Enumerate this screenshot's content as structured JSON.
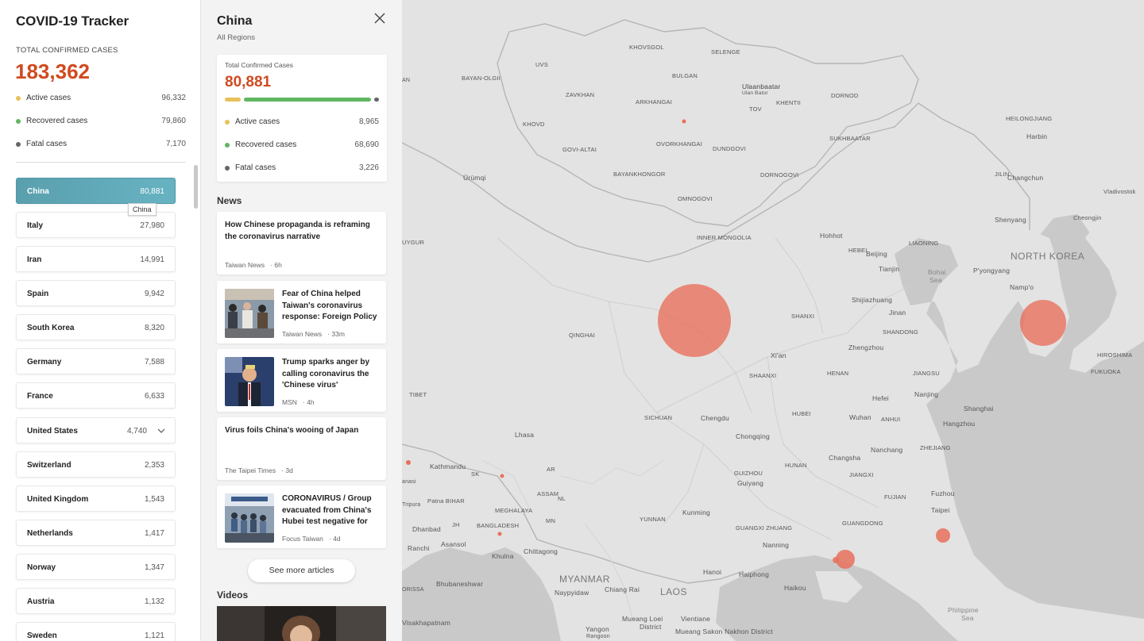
{
  "app": {
    "title": "COVID-19 Tracker"
  },
  "global": {
    "total_label": "TOTAL CONFIRMED CASES",
    "total_value": "183,362",
    "stats": [
      {
        "label": "Active cases",
        "value": "96,332",
        "color": "#e8c15a"
      },
      {
        "label": "Recovered cases",
        "value": "79,860",
        "color": "#5fb761"
      },
      {
        "label": "Fatal cases",
        "value": "7,170",
        "color": "#666666"
      }
    ]
  },
  "countries": [
    {
      "name": "China",
      "count": "80,881",
      "active": true
    },
    {
      "name": "Italy",
      "count": "27,980"
    },
    {
      "name": "Iran",
      "count": "14,991"
    },
    {
      "name": "Spain",
      "count": "9,942"
    },
    {
      "name": "South Korea",
      "count": "8,320"
    },
    {
      "name": "Germany",
      "count": "7,588"
    },
    {
      "name": "France",
      "count": "6,633"
    },
    {
      "name": "United States",
      "count": "4,740",
      "expandable": true
    },
    {
      "name": "Switzerland",
      "count": "2,353"
    },
    {
      "name": "United Kingdom",
      "count": "1,543"
    },
    {
      "name": "Netherlands",
      "count": "1,417"
    },
    {
      "name": "Norway",
      "count": "1,347"
    },
    {
      "name": "Austria",
      "count": "1,132"
    },
    {
      "name": "Sweden",
      "count": "1,121"
    }
  ],
  "tooltip": "China",
  "detail": {
    "region": "China",
    "subtitle": "All Regions",
    "summary": {
      "label": "Total Confirmed Cases",
      "value": "80,881",
      "stats": [
        {
          "label": "Active cases",
          "value": "8,965",
          "color": "#e8c15a"
        },
        {
          "label": "Recovered cases",
          "value": "68,690",
          "color": "#5fb761"
        },
        {
          "label": "Fatal cases",
          "value": "3,226",
          "color": "#666666"
        }
      ]
    },
    "news_heading": "News",
    "news": [
      {
        "title_lines": [
          "How Chinese propaganda is reframing",
          "the coronavirus narrative"
        ],
        "source": "Taiwan News",
        "age": "6h",
        "thumb": false
      },
      {
        "title_lines": [
          "Fear of China helped",
          "Taiwan's coronavirus",
          "response: Foreign Policy"
        ],
        "source": "Taiwan News",
        "age": "33m",
        "thumb": true
      },
      {
        "title_lines": [
          "Trump sparks anger by",
          "calling coronavirus the",
          "'Chinese virus'"
        ],
        "source": "MSN",
        "age": "4h",
        "thumb": true
      },
      {
        "title_lines": [
          "Virus foils China's wooing of Japan"
        ],
        "source": "The Taipei Times",
        "age": "3d",
        "thumb": false
      },
      {
        "title_lines": [
          "CORONAVIRUS / Group",
          "evacuated from China's",
          "Hubei test negative for"
        ],
        "source": "Focus Taiwan",
        "age": "4d",
        "thumb": true
      }
    ],
    "see_more": "See more articles",
    "videos_heading": "Videos"
  },
  "map": {
    "labels": [
      "KHOVSGOL",
      "SELENGE",
      "UVS",
      "BAYAN-OLGII",
      "BULGAN",
      "Ulaanbaatar",
      "Ulan Bator",
      "ZAVKHAN",
      "ARKHANGAI",
      "TOV",
      "KHENTII",
      "DORNOD",
      "KHOVD",
      "GOVI-ALTAI",
      "OVORKHANGAI",
      "DUNDGOVI",
      "SUKHBAATAR",
      "BAYANKHONGOR",
      "DORNOGOVI",
      "OMNOGOVI",
      "Ürümqi",
      "HEILONGJIANG",
      "Harbin",
      "JILIN",
      "Changchun",
      "Vladivostok",
      "Shenyang",
      "Cheongjin",
      "INNER MONGOLIA",
      "Hohhot",
      "LIAONING",
      "NORTH KOREA",
      "UYGUR",
      "HEBEI",
      "Beijing",
      "Tianjin",
      "Bohai",
      "Sea",
      "P'yongyang",
      "Namp'o",
      "Shijiazhuang",
      "SHANXI",
      "SHANDONG",
      "Jinan",
      "QINGHAI",
      "Zhengzhou",
      "Xi'an",
      "HIROSHIMA",
      "FUKUOKA",
      "HENAN",
      "SHAANXI",
      "JIANGSU",
      "TIBET",
      "Hefei",
      "Nanjing",
      "Shanghai",
      "SICHUAN",
      "Chengdu",
      "HUBEI",
      "Wuhan",
      "ANHUI",
      "Hangzhou",
      "Lhasa",
      "Chongqing",
      "Changsha",
      "Nanchang",
      "ZHEJIANG",
      "Kathmandu",
      "SK",
      "AR",
      "ASSAM",
      "NL",
      "HUNAN",
      "GUIZHOU",
      "Guiyang",
      "JIANGXI",
      "Patna BIHAR",
      "MEGHALAYA",
      "MN",
      "FUJIAN",
      "Fuzhou",
      "Taipei",
      "Dhanbad",
      "JH",
      "BANGLADESH",
      "Kunming",
      "YUNNAN",
      "GUANGXI ZHUANG",
      "GUANGDONG",
      "Ranchi",
      "Asansol",
      "Khulna",
      "Chittagong",
      "Nanning",
      "MYANMAR",
      "Hanoi",
      "Haiphong",
      "Bhubaneshwar",
      "Naypyidaw",
      "Chiang Rai",
      "LAOS",
      "Haikou",
      "Philippine",
      "Sea",
      "Visakhapatnam",
      "Yangon",
      "Mueang Loei",
      "District",
      "Vientiane",
      "Mueang Sakon Nakhon District",
      "Rangoon",
      "ORISSA",
      "Ranchi",
      "Ulaanbaatar",
      "AN",
      "Tripura",
      "anasi"
    ]
  },
  "colors": {
    "accent": "#d04a1f",
    "active_item": "#5fa8b8",
    "map_bubble": "#e8705c"
  }
}
